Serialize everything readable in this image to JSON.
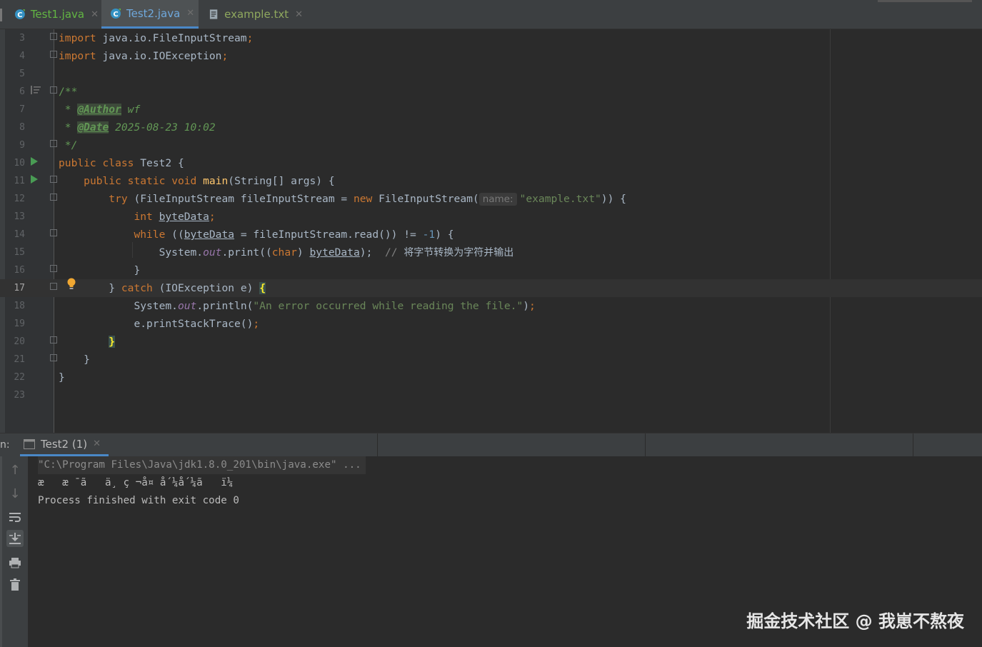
{
  "tabs": [
    {
      "label": "Test1.java",
      "type": "java",
      "active": false
    },
    {
      "label": "Test2.java",
      "type": "java",
      "active": true
    },
    {
      "label": "example.txt",
      "type": "txt",
      "active": false
    }
  ],
  "editor": {
    "current_line": "17",
    "lines": [
      {
        "n": "3"
      },
      {
        "n": "4"
      },
      {
        "n": "5"
      },
      {
        "n": "6"
      },
      {
        "n": "7"
      },
      {
        "n": "8"
      },
      {
        "n": "9"
      },
      {
        "n": "10"
      },
      {
        "n": "11"
      },
      {
        "n": "12"
      },
      {
        "n": "13"
      },
      {
        "n": "14"
      },
      {
        "n": "15"
      },
      {
        "n": "16"
      },
      {
        "n": "17"
      },
      {
        "n": "18"
      },
      {
        "n": "19"
      },
      {
        "n": "20"
      },
      {
        "n": "21"
      },
      {
        "n": "22"
      },
      {
        "n": "23"
      }
    ],
    "code": {
      "l3": {
        "kw": "import",
        "rest": " java.io.FileInputStream",
        "semi": ";"
      },
      "l4": {
        "kw": "import",
        "rest": " java.io.IOException",
        "semi": ";"
      },
      "l6": "/**",
      "l7": {
        "star": " * ",
        "tag": "@Author",
        "val": " wf"
      },
      "l8": {
        "star": " * ",
        "tag": "@Date",
        "val": " 2025-08-23 10:02"
      },
      "l9": " */",
      "l10": {
        "kw1": "public",
        "kw2": "class",
        "name": "Test2 {"
      },
      "l11": {
        "kw1": "public",
        "kw2": "static",
        "kw3": "void",
        "fn": "main",
        "rest": "(String[] args) {"
      },
      "l12": {
        "kw": "try",
        "a": " (FileInputStream fileInputStream = ",
        "kwnew": "new",
        "b": " FileInputStream(",
        "hint": "name:",
        "str": "\"example.txt\"",
        "c": ")) {"
      },
      "l13": {
        "kw": "int",
        "var": "byteData",
        "semi": ";"
      },
      "l14": {
        "kw": "while",
        "a": " ((",
        "var": "byteData",
        "b": " = fileInputStream.read()) != ",
        "num": "-1",
        "c": ") {"
      },
      "l15": {
        "a": "System.",
        "static": "out",
        "b": ".print((",
        "kw": "char",
        "c": ") ",
        "var": "byteData",
        "d": ");",
        "cmt": "  // ",
        "cn": "将字节转换为字符并输出"
      },
      "l16": "}",
      "l17": {
        "a": "} ",
        "kw": "catch",
        "b": " (IOException e) ",
        "brace": "{"
      },
      "l18": {
        "a": "System.",
        "static": "out",
        "b": ".println(",
        "str": "\"An error occurred while reading the file.\"",
        "c": ")",
        "semi": ";"
      },
      "l19": {
        "a": "e.printStackTrace()",
        "semi": ";"
      },
      "l20": "}",
      "l21": "}",
      "l22": "}"
    }
  },
  "run": {
    "label": "n:",
    "tab": "Test2 (1)",
    "console": [
      "\"C:\\Program Files\\Java\\jdk1.8.0_201\\bin\\java.exe\" ...",
      "æ   æ ¯ã   ä¸ ç ¬å¤ å´¼å´¼ã   ï¼",
      "Process finished with exit code 0"
    ]
  },
  "watermark": "掘金技术社区 @ 我崽不熬夜",
  "colors": {
    "keyword": "#cc7832",
    "string": "#6a8759",
    "comment": "#808080",
    "doc": "#629755",
    "accent": "#4a88c7"
  }
}
